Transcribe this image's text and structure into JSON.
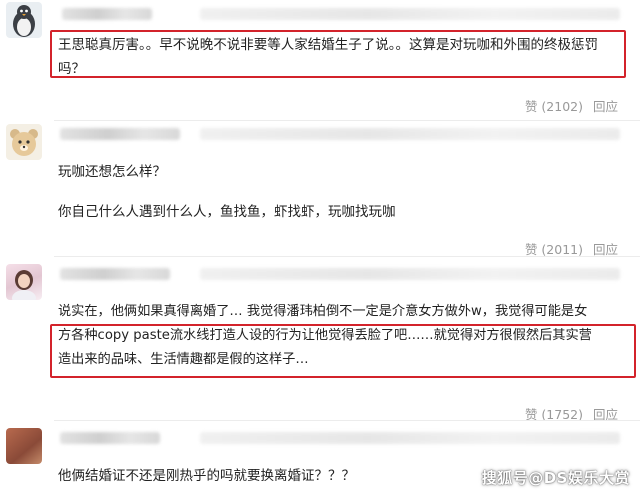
{
  "comments": [
    {
      "text": "王思聪真厉害。。早不说晚不说非要等人家结婚生子了说。。这算是对玩咖和外围的终极惩罚吗？",
      "likes": "赞 (2102)",
      "reply": "回应",
      "highlighted": true
    },
    {
      "lines": [
        "玩咖还想怎么样？",
        "你自己什么人遇到什么人，鱼找鱼，虾找虾，玩咖找玩咖"
      ],
      "likes": "赞 (2011)",
      "reply": "回应",
      "highlighted": false
    },
    {
      "line1": "说实在，他俩如果真得离婚了… 我觉得潘玮柏倒不一定是介意女方做外w，我觉得可能是女",
      "line2": "方各种copy paste流水线打造人设的行为让他觉得丢脸了吧……就觉得对方很假然后其实营",
      "line3": "造出来的品味、生活情趣都是假的这样子…",
      "likes": "赞 (1752)",
      "reply": "回应",
      "highlighted": true
    },
    {
      "text": "他俩结婚证不还是刚热乎的吗就要换离婚证？？？",
      "highlighted": false
    }
  ],
  "watermark": "搜狐号@DS娱乐大赏",
  "colors": {
    "highlight": "#d3232b",
    "meta": "#999999",
    "text": "#222222"
  }
}
